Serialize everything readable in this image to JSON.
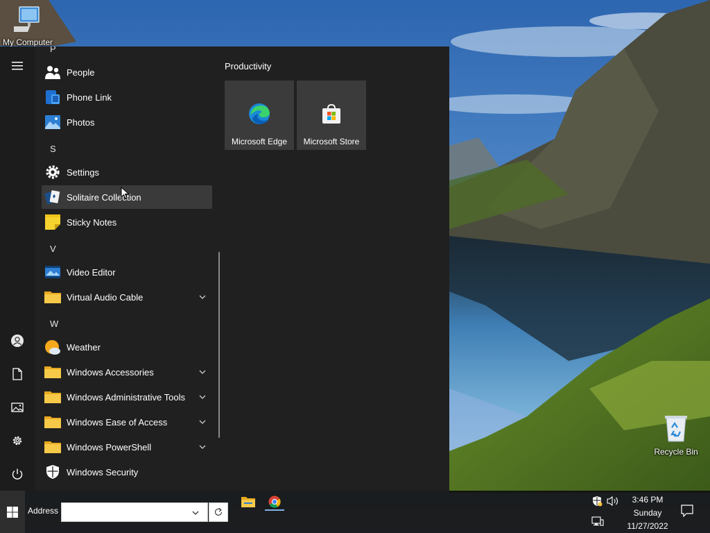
{
  "desktop": {
    "icons": {
      "my_computer": "My Computer",
      "recycle_bin": "Recycle Bin"
    }
  },
  "start_menu": {
    "partial_letter": "P",
    "app_list": [
      {
        "type": "app",
        "label": "People",
        "icon": "people-icon"
      },
      {
        "type": "app",
        "label": "Phone Link",
        "icon": "phone-link-icon"
      },
      {
        "type": "app",
        "label": "Photos",
        "icon": "photos-icon"
      },
      {
        "type": "letter",
        "label": "S"
      },
      {
        "type": "app",
        "label": "Settings",
        "icon": "gear-icon"
      },
      {
        "type": "app",
        "label": "Solitaire Collection",
        "icon": "cards-icon",
        "hovered": true
      },
      {
        "type": "app",
        "label": "Sticky Notes",
        "icon": "sticky-note-icon"
      },
      {
        "type": "letter",
        "label": "V"
      },
      {
        "type": "app",
        "label": "Video Editor",
        "icon": "video-editor-icon"
      },
      {
        "type": "folder",
        "label": "Virtual Audio Cable",
        "icon": "folder-icon"
      },
      {
        "type": "letter",
        "label": "W"
      },
      {
        "type": "app",
        "label": "Weather",
        "icon": "weather-icon"
      },
      {
        "type": "folder",
        "label": "Windows Accessories",
        "icon": "folder-icon"
      },
      {
        "type": "folder",
        "label": "Windows Administrative Tools",
        "icon": "folder-icon"
      },
      {
        "type": "folder",
        "label": "Windows Ease of Access",
        "icon": "folder-icon"
      },
      {
        "type": "folder",
        "label": "Windows PowerShell",
        "icon": "folder-icon"
      },
      {
        "type": "app",
        "label": "Windows Security",
        "icon": "shield-icon"
      }
    ],
    "tiles_group": {
      "title": "Productivity",
      "tiles": [
        {
          "label": "Microsoft Edge",
          "icon": "edge-icon"
        },
        {
          "label": "Microsoft Store",
          "icon": "store-icon"
        }
      ]
    }
  },
  "taskbar": {
    "address_label": "Address",
    "address_value": "",
    "pinned": [
      "file-explorer-icon",
      "chrome-icon"
    ],
    "clock": {
      "time": "3:46 PM",
      "day": "Sunday",
      "date": "11/27/2022"
    }
  },
  "colors": {
    "menu_bg": "#202020",
    "rail_bg": "#1c1c1c",
    "hover_bg": "#3a3a3a",
    "tile_bg": "#3b3b3b",
    "folder_yellow": "#f4c23b",
    "accent_blue": "#0078d4"
  }
}
